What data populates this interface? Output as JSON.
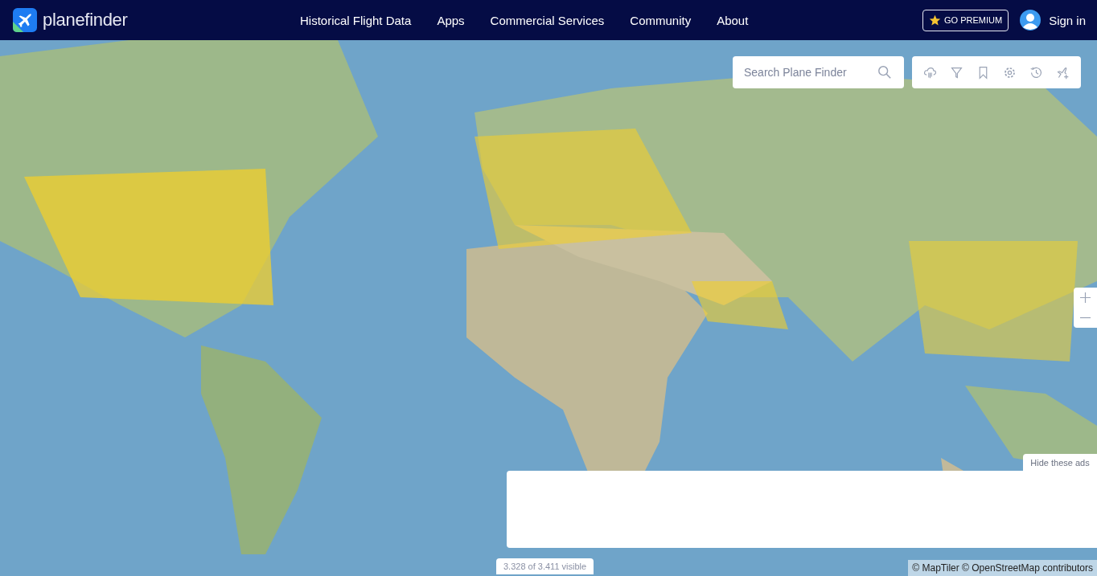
{
  "header": {
    "logo_text": "planefinder",
    "nav": [
      {
        "label": "Historical Flight Data"
      },
      {
        "label": "Apps"
      },
      {
        "label": "Commercial Services"
      },
      {
        "label": "Community"
      },
      {
        "label": "About"
      }
    ],
    "premium_button": "GO PREMIUM",
    "sign_in": "Sign in"
  },
  "map": {
    "kind": "picture",
    "search": {
      "placeholder": "Search Plane Finder"
    },
    "hide_ads": "Hide these ads",
    "visible_count": "3.328 of 3.411 visible",
    "attribution": "© MapTiler © OpenStreetMap contributors"
  }
}
